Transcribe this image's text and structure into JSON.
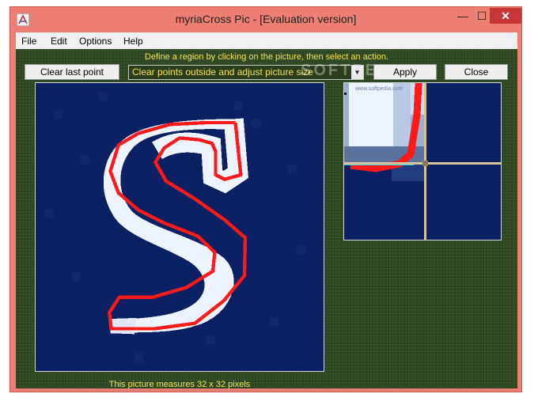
{
  "window": {
    "title": "myriaCross Pic - [Evaluation version]",
    "controls": {
      "minimize": "—",
      "maximize": "☐",
      "close": "✕"
    }
  },
  "menu": {
    "items": [
      "File",
      "Edit",
      "Options",
      "Help"
    ]
  },
  "toolbar": {
    "instruction": "Define a region by clicking on the picture, then select an action.",
    "clear_label": "Clear last point",
    "action_selected": "Clear points outside and adjust picture size",
    "apply_label": "Apply",
    "close_label": "Close"
  },
  "watermark": {
    "main": "SOFTPEDIA",
    "small": "www.softpedia.com"
  },
  "status": {
    "size_text": "This picture measures 32 x 32 pixels"
  },
  "colors": {
    "title_bg": "#ec7e73",
    "close_button": "#c7373a",
    "client_bg": "#2f4a22",
    "picture_bg": "#0c2064",
    "letter": "#eef4ff",
    "outline": "#ff1a1a",
    "text_yellow": "#f5e24a"
  },
  "icons": {
    "app": "app-icon",
    "dropdown": "chevron-down-icon"
  }
}
